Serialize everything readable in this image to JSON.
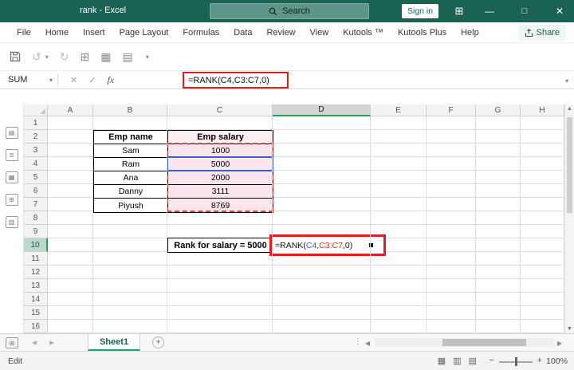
{
  "colors": {
    "titlebar_green": "#1a6352",
    "accent_green": "#21a366",
    "annotation_red": "#e01e1e",
    "reference_blue": "#3a60c4",
    "reference_red": "#c0392b",
    "salary_fill_pink": "#fce6ee"
  },
  "titlebar": {
    "title": "rank - Excel",
    "search_placeholder": "Search",
    "sign_in_label": "Sign in"
  },
  "menubar": {
    "items": [
      "File",
      "Home",
      "Insert",
      "Page Layout",
      "Formulas",
      "Data",
      "Review",
      "View",
      "Kutools ™",
      "Kutools Plus",
      "Help"
    ],
    "share_label": "Share"
  },
  "formula_bar": {
    "name_box_value": "SUM",
    "formula": "=RANK(C4,C3:C7,0)"
  },
  "grid": {
    "col_headers": [
      "A",
      "B",
      "C",
      "D",
      "E",
      "F",
      "G",
      "H"
    ],
    "row_headers": [
      "1",
      "2",
      "3",
      "4",
      "5",
      "6",
      "7",
      "8",
      "9",
      "10",
      "11",
      "12",
      "13",
      "14",
      "15",
      "16"
    ],
    "active_col": "D",
    "active_row": "10"
  },
  "sheet_content": {
    "emp_table": {
      "headers": [
        "Emp name",
        "Emp salary"
      ],
      "rows": [
        [
          "Sam",
          "1000"
        ],
        [
          "Ram",
          "5000"
        ],
        [
          "Ana",
          "2000"
        ],
        [
          "Danny",
          "3111"
        ],
        [
          "Piyush",
          "8769"
        ]
      ]
    },
    "rank_label": "Rank for salary = 5000",
    "d10_formula_parts": {
      "prefix": "=RANK(",
      "ref1": "C4",
      "sep": ",",
      "ref2": "C3:C7",
      "suffix": ",0)"
    }
  },
  "tab_bar": {
    "sheet_tab": "Sheet1",
    "add_sheet": "+"
  },
  "status_bar": {
    "mode": "Edit",
    "zoom": "100%"
  }
}
